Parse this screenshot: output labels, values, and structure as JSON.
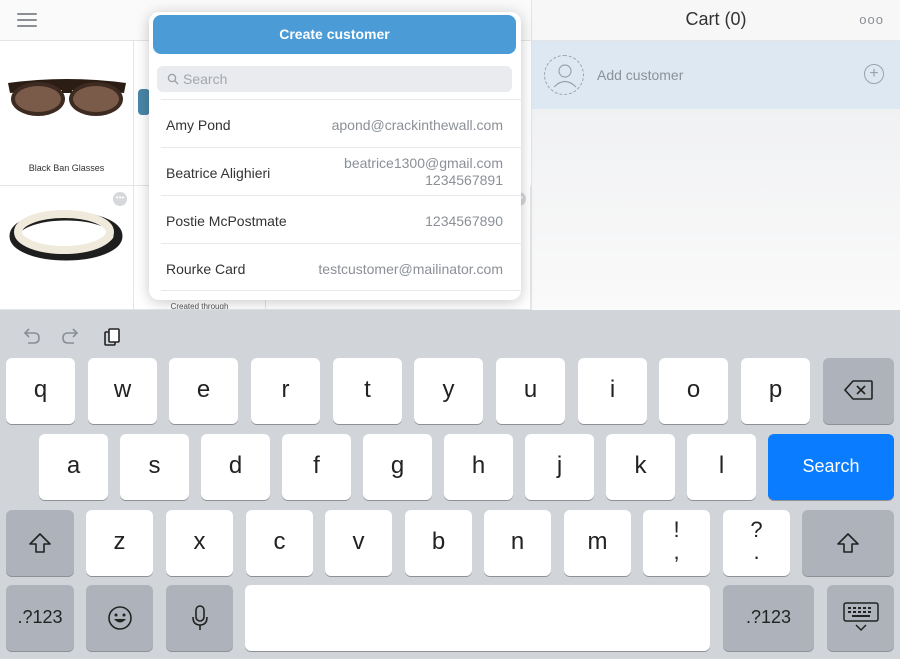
{
  "cart": {
    "title": "Cart (0)",
    "more_icon": "ooo",
    "add_customer_label": "Add customer",
    "add_icon": "+"
  },
  "products": [
    {
      "name": "Black Ban Glasses"
    },
    {
      "name": "Created through"
    }
  ],
  "popover": {
    "create_button_label": "Create customer",
    "search_placeholder": "Search",
    "customers": [
      {
        "name": "Amy Pond",
        "email": "apond@crackinthewall.com",
        "phone": ""
      },
      {
        "name": "Beatrice Alighieri",
        "email": "beatrice1300@gmail.com",
        "phone": "1234567891"
      },
      {
        "name": "Postie McPostmate",
        "email": "",
        "phone": "1234567890"
      },
      {
        "name": "Rourke Card",
        "email": "testcustomer@mailinator.com",
        "phone": ""
      }
    ]
  },
  "keyboard": {
    "row1": [
      "q",
      "w",
      "e",
      "r",
      "t",
      "y",
      "u",
      "i",
      "o",
      "p"
    ],
    "row2": [
      "a",
      "s",
      "d",
      "f",
      "g",
      "h",
      "j",
      "k",
      "l"
    ],
    "row3": [
      "z",
      "x",
      "c",
      "v",
      "b",
      "n",
      "m"
    ],
    "punct1": [
      "!",
      ","
    ],
    "punct2": [
      "?",
      "."
    ],
    "search_label": "Search",
    "numbers_label": ".?123",
    "icons": {
      "undo": "undo-icon",
      "redo": "redo-icon",
      "paste": "paste-icon",
      "delete": "delete-icon",
      "shift": "shift-icon",
      "emoji": "emoji-icon",
      "mic": "microphone-icon",
      "hide": "keyboard-hide-icon"
    }
  },
  "colors": {
    "accent": "#4a9bd6",
    "search_key": "#0a7cff",
    "keyboard_bg": "#d1d4d9"
  }
}
